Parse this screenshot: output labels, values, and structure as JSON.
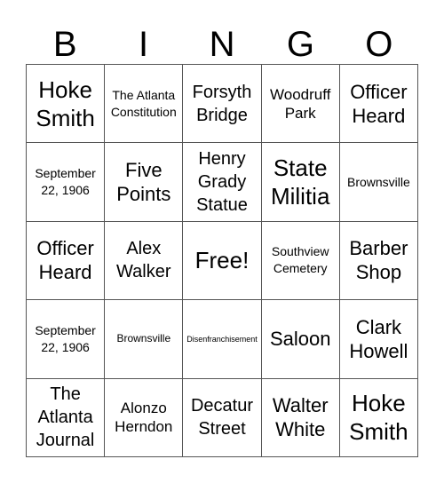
{
  "title_letters": [
    "B",
    "I",
    "N",
    "G",
    "O"
  ],
  "cells": [
    [
      {
        "text": "Hoke Smith",
        "size": "xl"
      },
      {
        "text": "The Atlanta Constitution",
        "size": "sm"
      },
      {
        "text": "Forsyth Bridge",
        "size": "l2"
      },
      {
        "text": "Woodruff Park",
        "size": "md"
      },
      {
        "text": "Officer Heard",
        "size": "lg"
      }
    ],
    [
      {
        "text": "September 22, 1906",
        "size": "sm"
      },
      {
        "text": "Five Points",
        "size": "lg"
      },
      {
        "text": "Henry Grady Statue",
        "size": "l2"
      },
      {
        "text": "State Militia",
        "size": "xl"
      },
      {
        "text": "Brownsville",
        "size": "sm"
      }
    ],
    [
      {
        "text": "Officer Heard",
        "size": "lg"
      },
      {
        "text": "Alex Walker",
        "size": "l2"
      },
      {
        "text": "Free!",
        "size": "xl"
      },
      {
        "text": "Southview Cemetery",
        "size": "sm"
      },
      {
        "text": "Barber Shop",
        "size": "lg"
      }
    ],
    [
      {
        "text": "September 22, 1906",
        "size": "sm"
      },
      {
        "text": "Brownsville",
        "size": "xs"
      },
      {
        "text": "Disenfranchisement",
        "size": "xxs"
      },
      {
        "text": "Saloon",
        "size": "lg"
      },
      {
        "text": "Clark Howell",
        "size": "lg"
      }
    ],
    [
      {
        "text": "The Atlanta Journal",
        "size": "l2"
      },
      {
        "text": "Alonzo Herndon",
        "size": "md"
      },
      {
        "text": "Decatur Street",
        "size": "l2"
      },
      {
        "text": "Walter White",
        "size": "lg"
      },
      {
        "text": "Hoke Smith",
        "size": "xl"
      }
    ]
  ]
}
